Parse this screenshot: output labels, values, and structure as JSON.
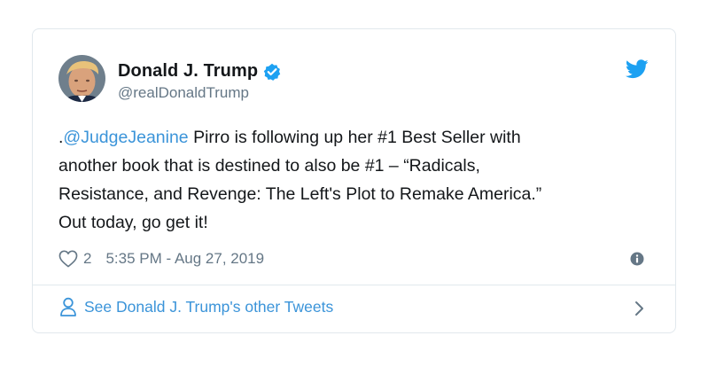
{
  "tweet": {
    "author_name": "Donald J. Trump",
    "handle": "@realDonaldTrump",
    "text_prefix": ".",
    "mention": "@JudgeJeanine",
    "text_body": " Pirro is following up her #1 Best Seller with\nanother book that is destined to also be #1 – “Radicals,\nResistance, and Revenge: The Left's Plot to Remake America.”\nOut today, go get it!",
    "like_count": "2",
    "timestamp": "5:35 PM - Aug 27, 2019"
  },
  "footer": {
    "other_tweets_label": "See Donald J. Trump's other Tweets"
  },
  "icons": {
    "verified": "verified-badge-icon",
    "bird": "twitter-bird-icon",
    "heart": "heart-icon",
    "info": "info-icon",
    "person": "person-icon",
    "chevron": "chevron-right-icon"
  },
  "colors": {
    "accent": "#1da1f2",
    "link": "#3b94d9",
    "text": "#14171a",
    "muted": "#657786",
    "border": "#e1e8ed"
  }
}
